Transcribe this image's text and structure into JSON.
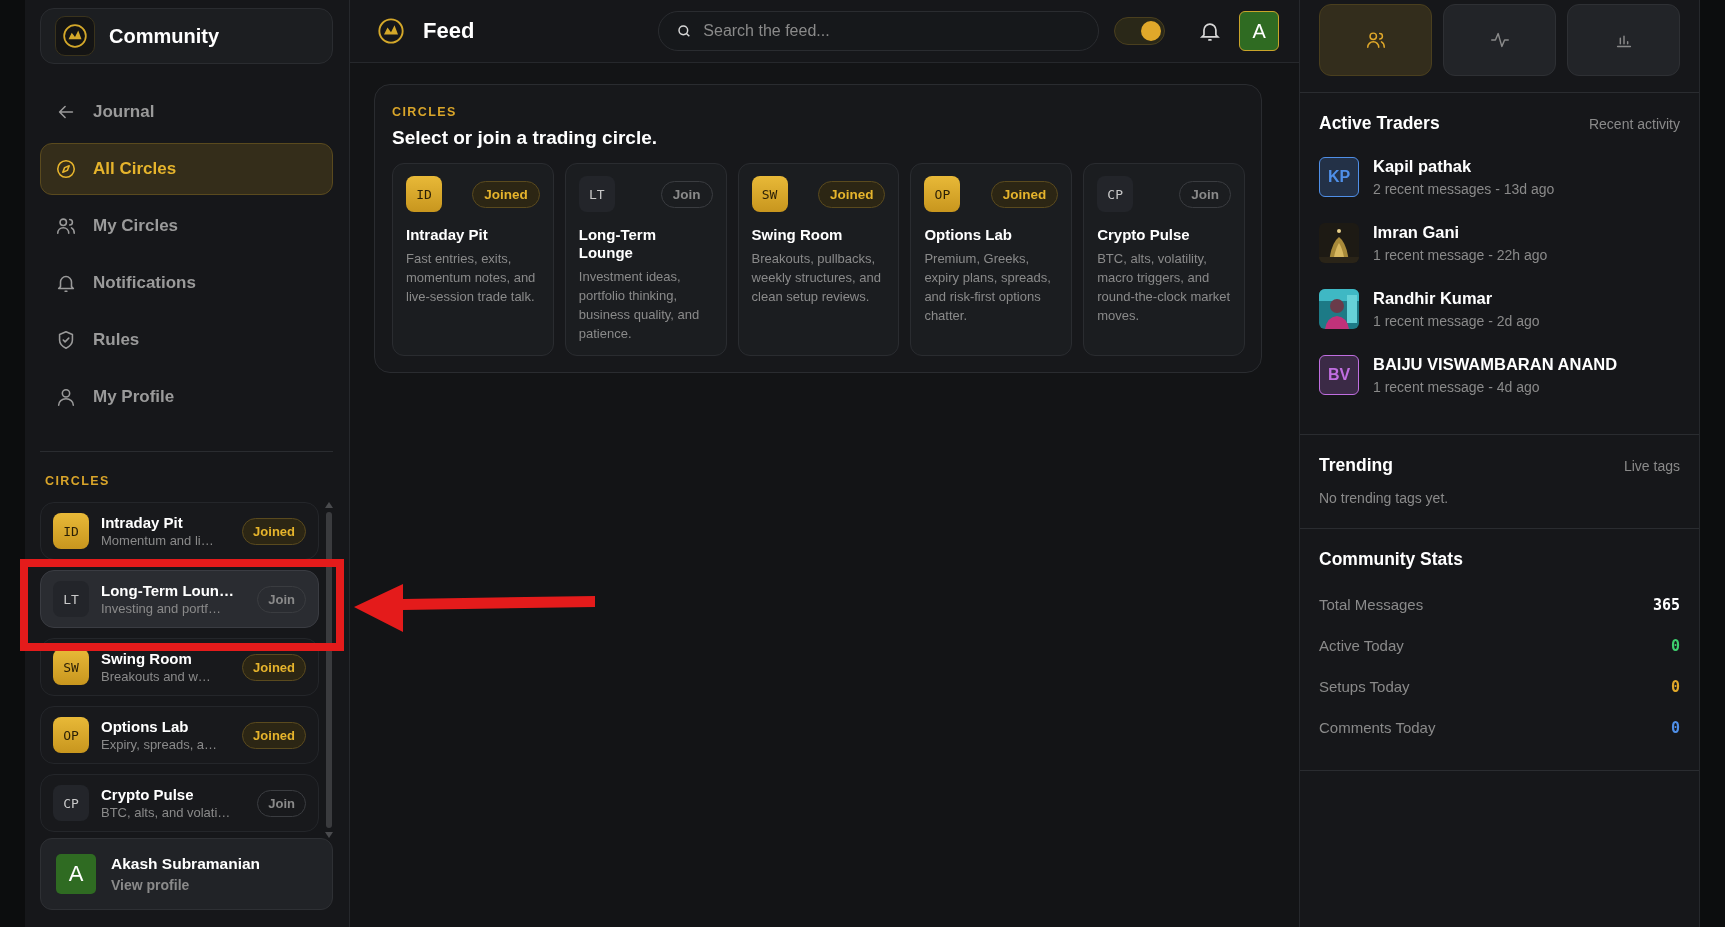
{
  "sidebar": {
    "brand": "Community",
    "nav": [
      {
        "kind": "back",
        "label": "Journal",
        "selected": false
      },
      {
        "kind": "compass",
        "label": "All Circles",
        "selected": true
      },
      {
        "kind": "users",
        "label": "My Circles",
        "selected": false
      },
      {
        "kind": "bell",
        "label": "Notifications",
        "selected": false
      },
      {
        "kind": "shield",
        "label": "Rules",
        "selected": false
      },
      {
        "kind": "user",
        "label": "My Profile",
        "selected": false
      }
    ],
    "section_title": "CIRCLES",
    "circles": [
      {
        "initials": "ID",
        "name": "Intraday Pit",
        "snippet": "Momentum and li…",
        "joined": true,
        "button": "Joined",
        "selected": false
      },
      {
        "initials": "LT",
        "name": "Long-Term Loun…",
        "snippet": "Investing and portf…",
        "joined": false,
        "button": "Join",
        "selected": true
      },
      {
        "initials": "SW",
        "name": "Swing Room",
        "snippet": "Breakouts and w…",
        "joined": true,
        "button": "Joined",
        "selected": false
      },
      {
        "initials": "OP",
        "name": "Options Lab",
        "snippet": "Expiry, spreads, a…",
        "joined": true,
        "button": "Joined",
        "selected": false
      },
      {
        "initials": "CP",
        "name": "Crypto Pulse",
        "snippet": "BTC, alts, and volati…",
        "joined": false,
        "button": "Join",
        "selected": false
      }
    ],
    "profile": {
      "initial": "A",
      "name": "Akash Subramanian",
      "link": "View profile"
    }
  },
  "header": {
    "title": "Feed",
    "search": {
      "placeholder": "Search the feed..."
    },
    "theme_toggle": {
      "on": true
    },
    "avatar": "A"
  },
  "circles_panel": {
    "eyebrow": "CIRCLES",
    "heading": "Select or join a trading circle.",
    "cards": [
      {
        "initials": "ID",
        "button": "Joined",
        "joined": true,
        "name": "Intraday Pit",
        "description": "Fast entries, exits, momentum notes, and live-session trade talk."
      },
      {
        "initials": "LT",
        "button": "Join",
        "joined": false,
        "name": "Long-Term Lounge",
        "description": "Investment ideas, portfolio thinking, business quality, and patience."
      },
      {
        "initials": "SW",
        "button": "Joined",
        "joined": true,
        "name": "Swing Room",
        "description": "Breakouts, pullbacks, weekly structures, and clean setup reviews."
      },
      {
        "initials": "OP",
        "button": "Joined",
        "joined": true,
        "name": "Options Lab",
        "description": "Premium, Greeks, expiry plans, spreads, and risk-first options chatter."
      },
      {
        "initials": "CP",
        "button": "Join",
        "joined": false,
        "name": "Crypto Pulse",
        "description": "BTC, alts, volatility, macro triggers, and round-the-clock market moves."
      }
    ]
  },
  "right_panel": {
    "tabs": [
      {
        "kind": "users",
        "selected": true
      },
      {
        "kind": "pulse",
        "selected": false
      },
      {
        "kind": "bars",
        "selected": false
      }
    ],
    "active_traders": {
      "title": "Active Traders",
      "subtitle": "Recent activity",
      "traders": [
        {
          "name": "Kapil pathak",
          "activity": "2 recent messages - 13d ago",
          "avatar": {
            "kind": "initials",
            "text": "KP",
            "color": "#4f8fe8"
          }
        },
        {
          "name": "Imran Gani",
          "activity": "1 recent message - 22h ago"
        },
        {
          "name": "Randhir Kumar",
          "activity": "1 recent message - 2d ago"
        },
        {
          "name": "BAIJU VISWAMBARAN ANAND",
          "activity": "1 recent message - 4d ago",
          "avatar": {
            "kind": "initials",
            "text": "BV",
            "color": "#c06ee0"
          }
        }
      ]
    },
    "trending": {
      "title": "Trending",
      "subtitle": "Live tags",
      "empty": "No trending tags yet."
    },
    "stats": {
      "title": "Community Stats",
      "rows": [
        {
          "label": "Total Messages",
          "value": "365",
          "color": "#ffffff"
        },
        {
          "label": "Active Today",
          "value": "0",
          "color": "#3ecf6e"
        },
        {
          "label": "Setups Today",
          "value": "0",
          "color": "#e0a82a"
        },
        {
          "label": "Comments Today",
          "value": "0",
          "color": "#4f8fe8"
        }
      ]
    }
  }
}
